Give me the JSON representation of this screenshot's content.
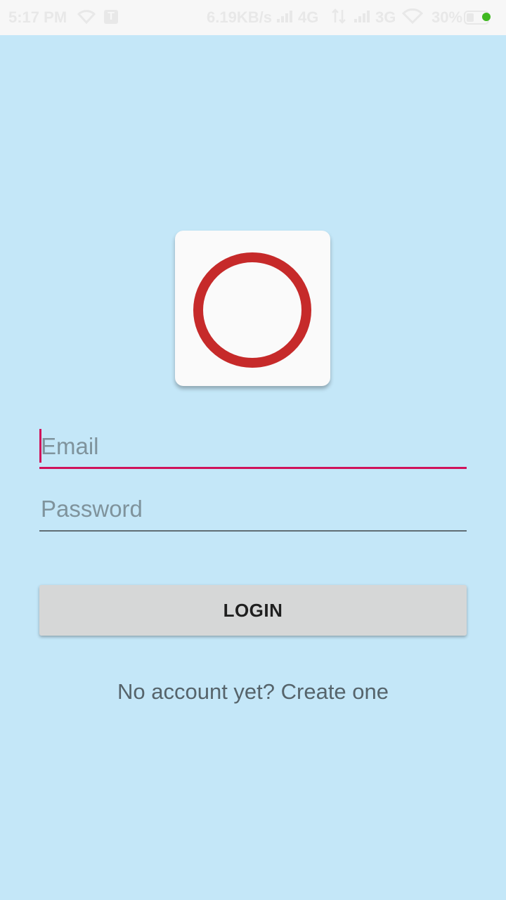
{
  "status_bar": {
    "time": "5:17 PM",
    "notification_badge": "T",
    "network_speed": "6.19KB/s",
    "network_1": "4G",
    "network_2": "3G",
    "battery_percent": "30%",
    "icons": [
      "wifi-icon",
      "notification-icon",
      "signal-icon",
      "data-arrows-icon",
      "signal-icon",
      "wifi-icon",
      "battery-icon"
    ]
  },
  "logo": {
    "icon": "circle-o-logo",
    "color": "#c62a2a"
  },
  "form": {
    "email_placeholder": "Email",
    "email_value": "",
    "password_placeholder": "Password",
    "password_value": "",
    "login_label": "LOGIN",
    "signup_text": "No account yet? Create one"
  },
  "colors": {
    "background": "#c4e7f8",
    "accent": "#d0135b",
    "button": "#d6d7d7"
  }
}
